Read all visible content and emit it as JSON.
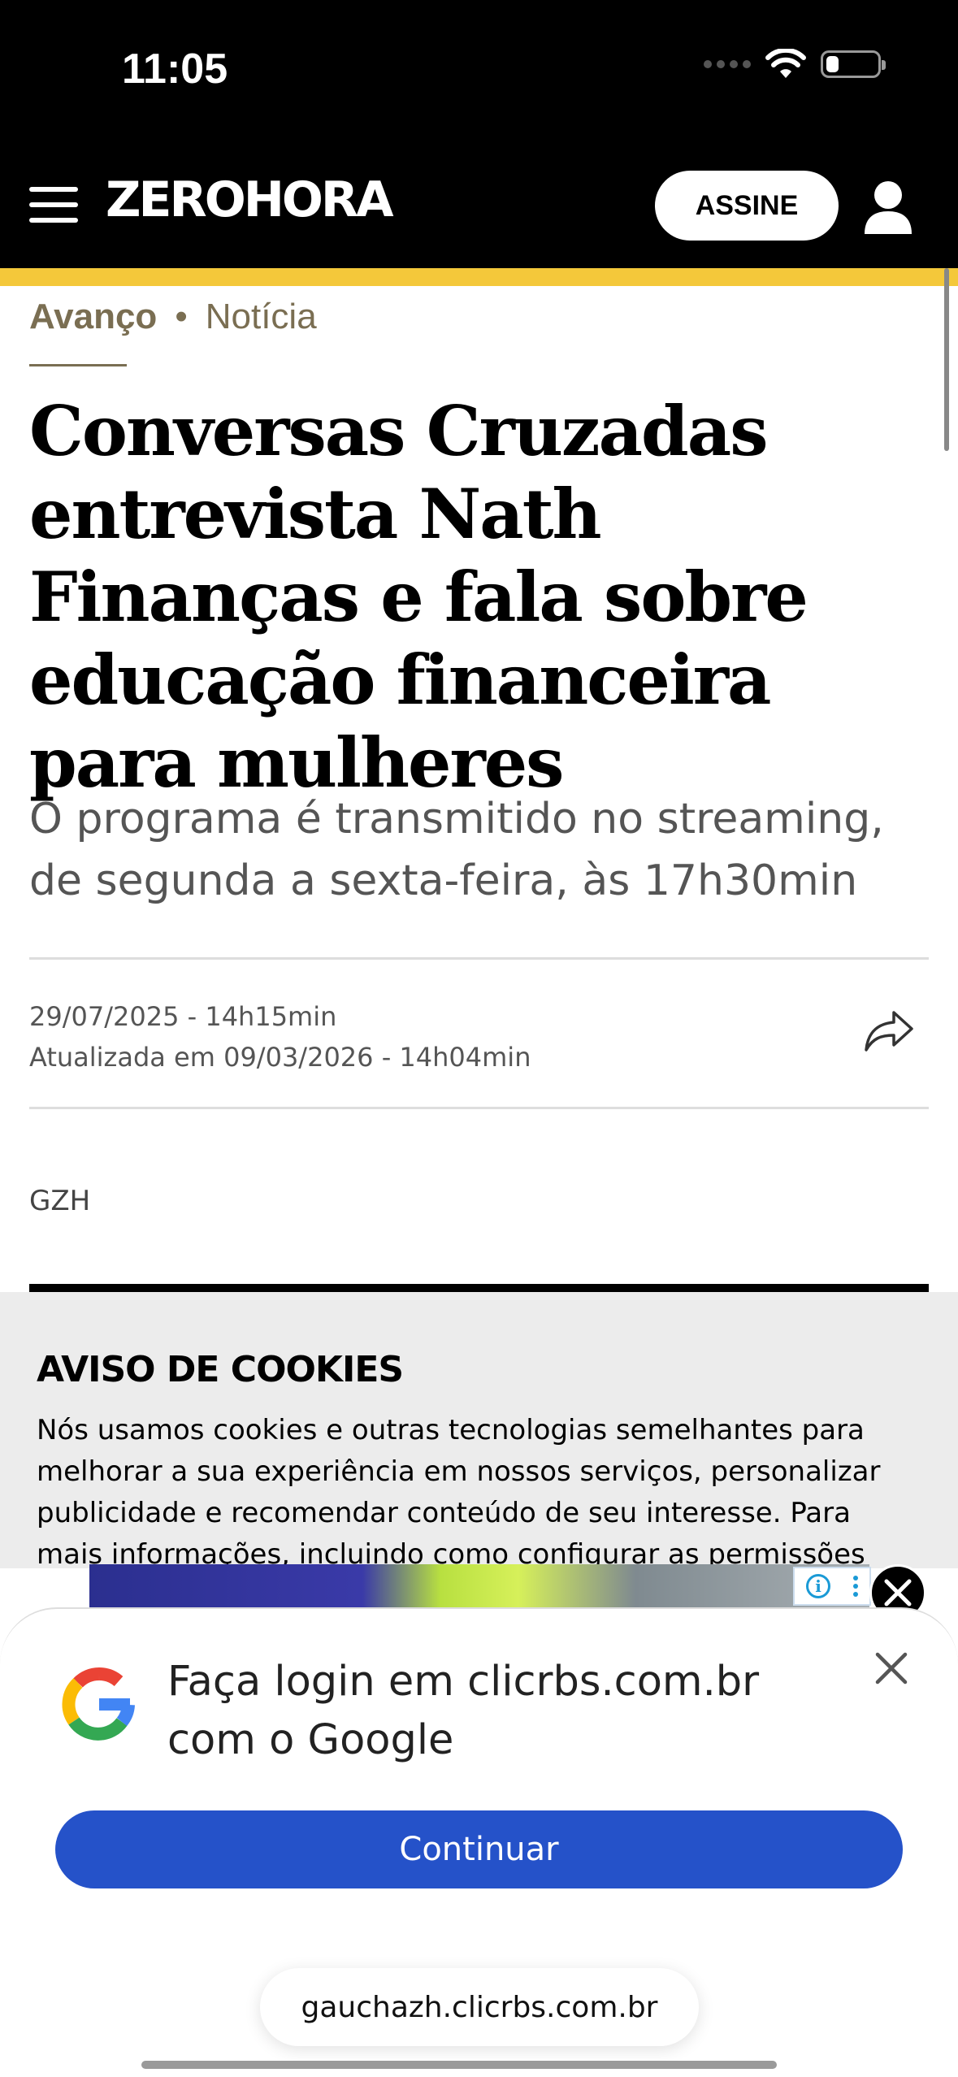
{
  "status_bar": {
    "time": "11:05",
    "battery_level": 0.25
  },
  "header": {
    "logo": "ZEROHORA",
    "subscribe_label": "ASSINE",
    "bg_color": "#000000",
    "accent_color": "#f4c83a"
  },
  "article": {
    "section": "Avanço",
    "separator": "•",
    "type": "Notícia",
    "headline": "Conversas Cruzadas entrevista Nath Finanças e fala sobre educação financeira para mulheres",
    "subtitle": "O programa é transmitido no streaming, de segunda a sexta-feira, às 17h30min",
    "published": "29/07/2025 - 14h15min",
    "updated": "Atualizada em 09/03/2026 - 14h04min",
    "author": "GZH"
  },
  "cookie_notice": {
    "title": "AVISO DE COOKIES",
    "text": "Nós usamos cookies e outras tecnologias semelhantes para melhorar a sua experiência em nossos serviços, personalizar publicidade e recomendar conteúdo de seu interesse. Para mais informações, incluindo como configurar as permissões dos"
  },
  "google_signin": {
    "title": "Faça login em clicrbs.com.br com o Google",
    "continue_label": "Continuar",
    "button_color": "#2552c9"
  },
  "browser": {
    "url": "gauchazh.clicrbs.com.br"
  }
}
